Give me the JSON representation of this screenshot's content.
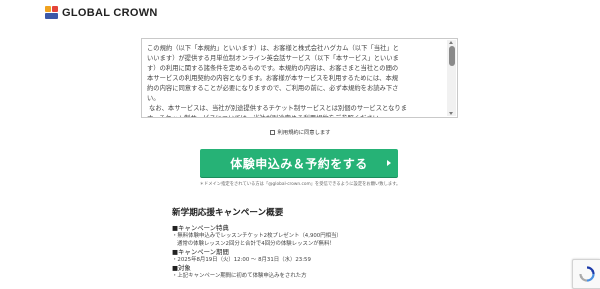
{
  "header": {
    "logo_text": "GLOBAL CROWN",
    "logo_colors": [
      "#f0a21f",
      "#e4443a",
      "#3b58a8"
    ]
  },
  "terms": {
    "text": "この規約（以下「本規約」といいます）は、お客様と株式会社ハグカム（以下「当社」と\nいいます）が提供する月単位制オンライン英会話サービス（以下「本サービス」といいま\nす）の利用に関する諸条件を定めるものです。本規約の内容は、お客さまと当社との間の\n本サービスの利用契約の内容となります。お客様が本サービスを利用するためには、本規\n約の内容に同意することが必要になりますので、ご利用の前に、必ず本規約をお読み下さ\nい。\n なお、本サービスは、当社が別途提供するチケット制サービスとは別個のサービスとなりま\nす。チケット制サービスについては、当社が別途定める利用規約をご参照ください。"
  },
  "agree": {
    "label": "利用規約に同意します"
  },
  "cta": {
    "label": "体験申込み＆予約をする",
    "color": "#26b276"
  },
  "note": {
    "text": "＊ドメイン指定をされている方は「@global-crown.com」を受信できるように設定をお願い致します。"
  },
  "campaign": {
    "title": "新学期応援キャンペーン概要",
    "sections": [
      {
        "head": "■キャンペーン特典",
        "lines": [
          "・無料体験申込みでレッスンチケット2枚プレゼント（4,900円相当）",
          "通常の体験レッスン2回分と合計で4回分の体験レッスンが無料！"
        ]
      },
      {
        "head": "■キャンペーン期間",
        "lines": [
          "・2025年8月19日（火）12:00 ～ 8月31日（水）23:59"
        ]
      },
      {
        "head": "■対象",
        "lines": [
          "・上記キャンペーン期間に初めて体験申込みをされた方"
        ]
      }
    ]
  }
}
